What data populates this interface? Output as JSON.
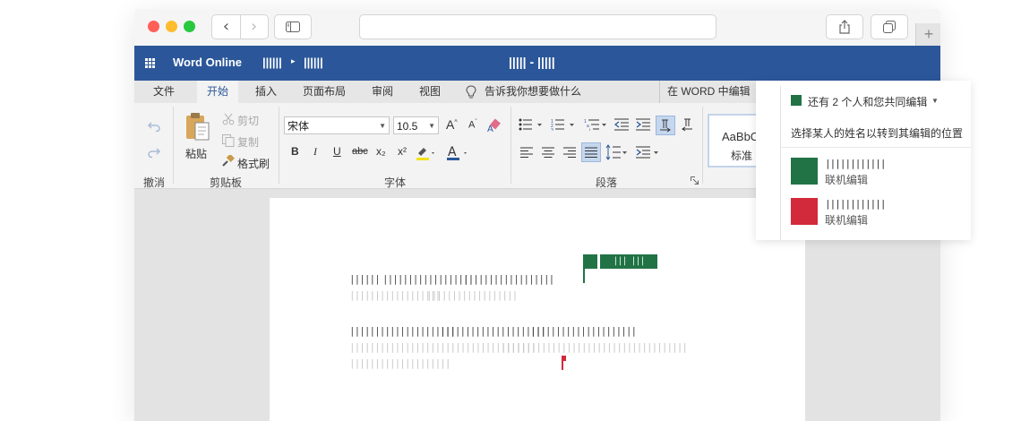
{
  "browser": {
    "back_icon": "chevron-left-icon",
    "forward_icon": "chevron-right-icon",
    "new_tab_label": "+"
  },
  "app": {
    "name": "Word Online",
    "breadcrumb_1": "||||||",
    "breadcrumb_sep": "▸",
    "breadcrumb_2": "||||||",
    "doc_title": "||||| - |||||"
  },
  "menu": {
    "tabs": [
      "文件",
      "开始",
      "插入",
      "页面布局",
      "审阅",
      "视图"
    ],
    "active_tab": "开始",
    "tell_me": "告诉我你想要做什么",
    "edit_in_word": "在 WORD 中编辑"
  },
  "ribbon": {
    "undo_group": "撤消",
    "clipboard_group": "剪贴板",
    "paste": "粘贴",
    "cut": "剪切",
    "copy": "复制",
    "format_painter": "格式刷",
    "font_group": "字体",
    "font_name": "宋体",
    "font_size": "10.5",
    "bold": "B",
    "italic": "I",
    "underline": "U",
    "strike": "abc",
    "subscript": "x₂",
    "superscript": "x²",
    "paragraph_group": "段落",
    "style_preview": "AaBbCcD",
    "style_name": "标准"
  },
  "document": {
    "line1_a": "||||||",
    "line1_b": "||||||||||||||||||",
    "line1_c": "||||||||||||||||||",
    "line2_a": "||||||||||||||||||",
    "line2_b": "||||||||||||||||||",
    "line3_a": "|||||||||||||||||||||",
    "line3_b": "|||||||||||||||||||||",
    "line3_c": "|||||||||||||||||||||",
    "line4_a": "|||||||||||||||||||||||||||||||||||||",
    "line4_b": "|||||||||||||||||||||||||||||||||||||",
    "line5": "||||||||||||||||||||",
    "cursor_label": "||| |||"
  },
  "coauthoring": {
    "header": "还有 2 个人和您共同编辑",
    "hint": "选择某人的姓名以转到其编辑的位置",
    "users": [
      {
        "name": "||||||||||||",
        "status": "联机编辑",
        "color": "#217346"
      },
      {
        "name": "||||||||||||",
        "status": "联机编辑",
        "color": "#d22a3a"
      }
    ]
  },
  "colors": {
    "word_blue": "#2b579a",
    "user1": "#217346",
    "user2": "#d22a3a"
  }
}
